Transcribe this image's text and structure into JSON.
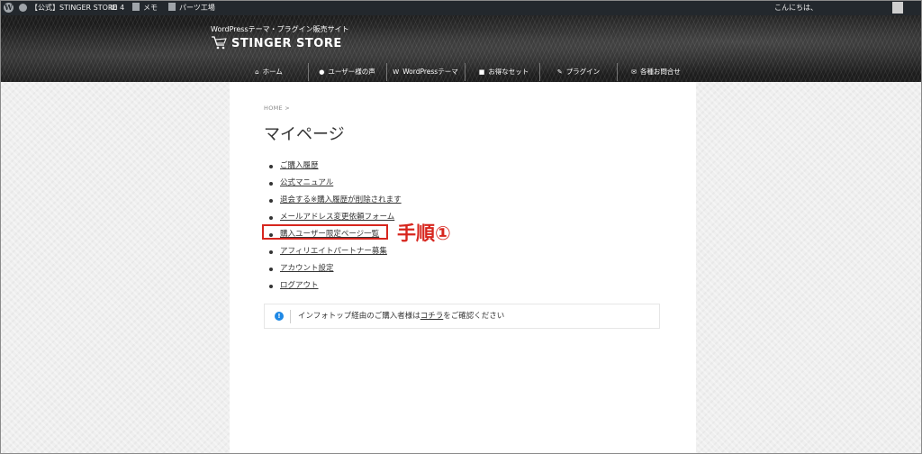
{
  "admin_bar": {
    "site": "【公式】STINGER STORE",
    "id_count": "ID 4",
    "memo": "メモ",
    "parts": "パーツ工場",
    "greeting": "こんにちは、"
  },
  "header": {
    "tagline": "WordPressテーマ・プラグイン販売サイト",
    "logo": "STINGER STORE",
    "nav": [
      {
        "label": "ホーム",
        "icon": "home-icon",
        "glyph": "⌂"
      },
      {
        "label": "ユーザー様の声",
        "icon": "comments-icon",
        "glyph": "●"
      },
      {
        "label": "WordPressテーマ",
        "icon": "wordpress-icon",
        "glyph": "W"
      },
      {
        "label": "お得なセット",
        "icon": "gift-icon",
        "glyph": "■"
      },
      {
        "label": "プラグイン",
        "icon": "plug-icon",
        "glyph": "✎"
      },
      {
        "label": "各種お問合せ",
        "icon": "envelope-icon",
        "glyph": "✉"
      }
    ]
  },
  "breadcrumb": "HOME >",
  "page_title": "マイページ",
  "menu": [
    "ご購入履歴",
    "公式マニュアル",
    "退会する※購入履歴が削除されます",
    "メールアドレス変更依頼フォーム",
    "購入ユーザー限定ページ一覧",
    "アフィリエイトパートナー募集",
    "アカウント設定",
    "ログアウト"
  ],
  "annotation": "手順①",
  "notice": {
    "icon": "info-icon",
    "before": "インフォトップ経由のご購入者様は",
    "link": "コチラ",
    "after": "をご確認ください"
  },
  "colors": {
    "accent": "#d7261e",
    "info": "#1e88e5",
    "admin_bar": "#23282d"
  }
}
